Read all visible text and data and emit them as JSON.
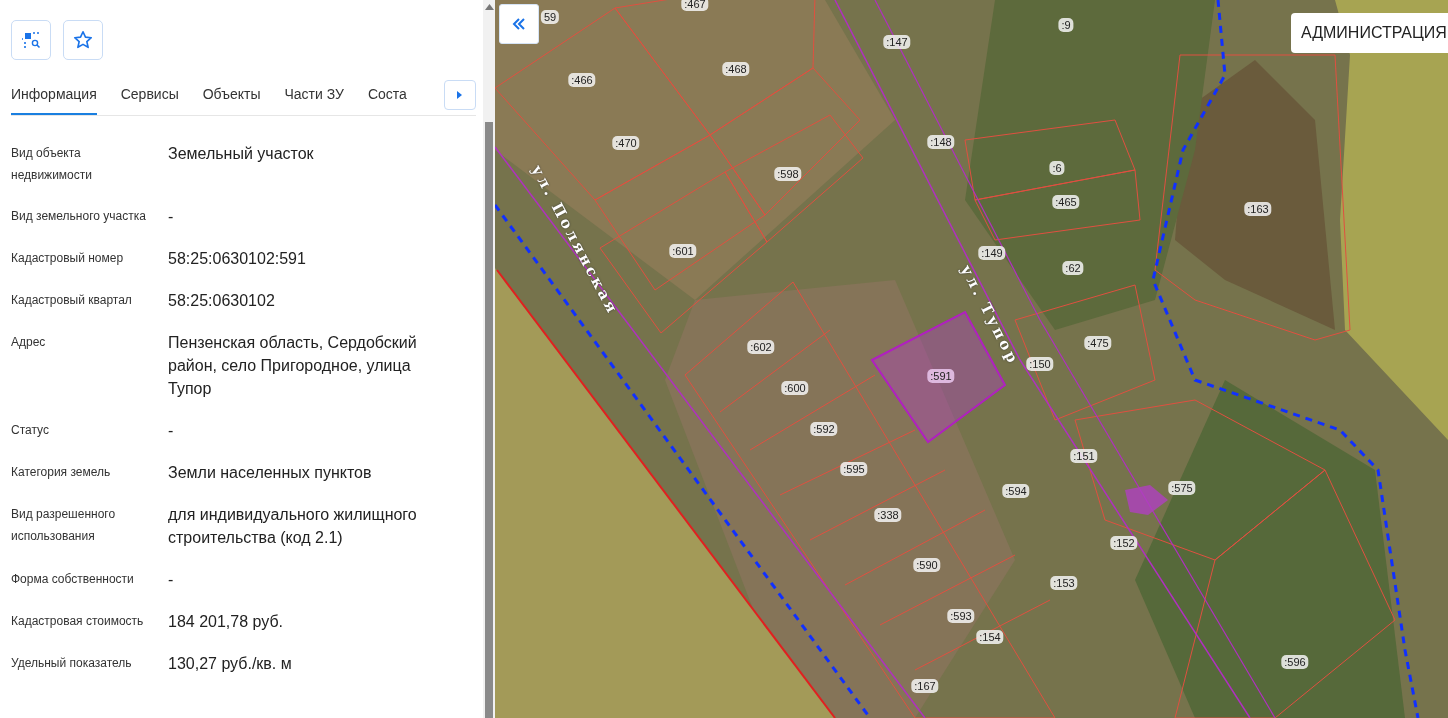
{
  "tabs": [
    {
      "label": "Информация",
      "selected": true
    },
    {
      "label": "Сервисы",
      "selected": false
    },
    {
      "label": "Объекты",
      "selected": false
    },
    {
      "label": "Части ЗУ",
      "selected": false
    },
    {
      "label": "Соста",
      "selected": false
    }
  ],
  "properties": [
    {
      "label": "Вид объекта недвижимости",
      "value": "Земельный участок"
    },
    {
      "label": "Вид земельного участка",
      "value": "-"
    },
    {
      "label": "Кадастровый номер",
      "value": "58:25:0630102:591"
    },
    {
      "label": "Кадастровый квартал",
      "value": "58:25:0630102"
    },
    {
      "label": "Адрес",
      "value": "Пензенская область, Сердобский район, село Пригородное, улица Тупор"
    },
    {
      "label": "Статус",
      "value": "-"
    },
    {
      "label": "Категория земель",
      "value": "Земли населенных пунктов"
    },
    {
      "label": "Вид разрешенного использования",
      "value": "для индивидуального жилищного строительства (код 2.1)"
    },
    {
      "label": "Форма собственности",
      "value": "-"
    },
    {
      "label": "Кадастровая стоимость",
      "value": "184 201,78 руб."
    },
    {
      "label": "Удельный показатель",
      "value": "130,27 руб./кв. м"
    }
  ],
  "map": {
    "admin_label": "АДМИНИСТРАЦИЯ",
    "streets": [
      "ул. Полянская",
      "ул. Тупор"
    ],
    "parcels": [
      {
        "label": "59",
        "selected": false
      },
      {
        "label": ":467",
        "selected": false
      },
      {
        "label": ":147",
        "selected": false
      },
      {
        "label": ":9",
        "selected": false
      },
      {
        "label": ":466",
        "selected": false
      },
      {
        "label": ":468",
        "selected": false
      },
      {
        "label": ":470",
        "selected": false
      },
      {
        "label": ":148",
        "selected": false
      },
      {
        "label": ":6",
        "selected": false
      },
      {
        "label": ":598",
        "selected": false
      },
      {
        "label": ":465",
        "selected": false
      },
      {
        "label": ":163",
        "selected": false
      },
      {
        "label": ":601",
        "selected": false
      },
      {
        "label": ":149",
        "selected": false
      },
      {
        "label": ":62",
        "selected": false
      },
      {
        "label": ":602",
        "selected": false
      },
      {
        "label": ":475",
        "selected": false
      },
      {
        "label": ":591",
        "selected": true
      },
      {
        "label": ":150",
        "selected": false
      },
      {
        "label": ":600",
        "selected": false
      },
      {
        "label": ":592",
        "selected": false
      },
      {
        "label": ":151",
        "selected": false
      },
      {
        "label": ":595",
        "selected": false
      },
      {
        "label": ":594",
        "selected": false
      },
      {
        "label": ":575",
        "selected": false
      },
      {
        "label": ":338",
        "selected": false
      },
      {
        "label": ":152",
        "selected": false
      },
      {
        "label": ":590",
        "selected": false
      },
      {
        "label": ":153",
        "selected": false
      },
      {
        "label": ":593",
        "selected": false
      },
      {
        "label": ":154",
        "selected": false
      },
      {
        "label": ":596",
        "selected": false
      },
      {
        "label": ":167",
        "selected": false
      }
    ]
  }
}
